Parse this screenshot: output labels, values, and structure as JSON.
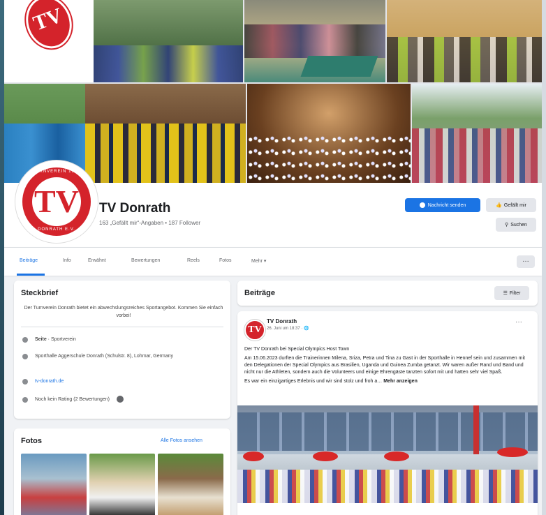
{
  "page": {
    "name": "TV Donrath",
    "subtitle": "163 „Gefällt mir“-Angaben • 187 Follower",
    "logo_text_top": "TURNVEREIN 1908",
    "logo_text_bottom": "DONRATH E.V.",
    "logo_monogram": "TV"
  },
  "actions": {
    "message": "Nachricht senden",
    "like": "Gefällt mir",
    "search": "Suchen",
    "more": "…"
  },
  "tabs": [
    "Beiträge",
    "Info",
    "Erwähnt",
    "Bewertungen",
    "Reels",
    "Fotos",
    "Mehr ▾"
  ],
  "intro": {
    "title": "Steckbrief",
    "text": "Der Turnverein Donrath bietet ein abwechslungsreiches Sportangebot. Kommen Sie einfach vorbei!",
    "category_label": "Seite",
    "category": " · Sportverein",
    "address": "Sporthalle Aggerschule Donrath (Schulstr. 8), Lohmar, Germany",
    "website": "tv-donrath.de",
    "rating": "Noch kein Rating (2 Bewertungen)"
  },
  "photos": {
    "title": "Fotos",
    "see_all": "Alle Fotos ansehen"
  },
  "posts": {
    "title": "Beiträge",
    "filter": "Filter",
    "author": "TV Donrath",
    "date": "26. Juni um 18:37 · ",
    "headline": "Der TV Donrath bei Special Olympics Host Town",
    "body": "Am 15.06.2023 durften die Trainerinnen Milena, Sriza, Petra und Tina zu Gast in der Sporthalle in Hennef sein und zusammen mit den Delegationen der Special Olympics aus Brasilien, Uganda und Guinea Zumba getanzt. Wir waren außer Rand und Band und nicht nur die Athleten, sondern auch die Volunteers und einige Ehrengäste tanzten sofort mit und hatten sehr viel Spaß.",
    "tail": "Es war ein einzigartiges Erlebnis und wir sind stolz und froh a…",
    "more_link": "Mehr anzeigen",
    "options": "···"
  },
  "colors": {
    "accent": "#1b74e4",
    "brand_red": "#d4232b",
    "background": "#f0f2f5"
  },
  "icons": [
    "messenger-icon",
    "like-icon",
    "search-icon",
    "filter-icon",
    "info-icon",
    "location-icon",
    "link-icon",
    "star-icon",
    "globe-icon"
  ]
}
